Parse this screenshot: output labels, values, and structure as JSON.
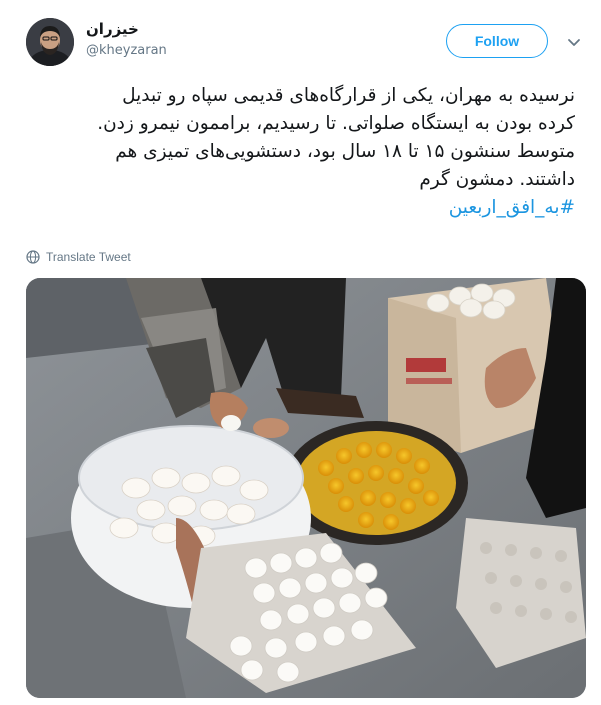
{
  "author": {
    "display_name": "خیزران",
    "handle": "@kheyzaran"
  },
  "follow_button": {
    "label": "Follow"
  },
  "tweet": {
    "lines": [
      "نرسیده به مهران، یکی از قرارگاه‌های قدیمی سپاه رو تبدیل",
      "کرده بودن به ایستگاه صلواتی. تا رسیدیم، براممون نیمرو زدن.",
      "متوسط سنشون ۱۵ تا ۱۸ سال بود، دستشویی‌های تمیزی هم",
      "داشتند. دمشون گرم"
    ],
    "hashtag": "#به_افق_اربعین"
  },
  "translate": {
    "label": "Translate Tweet"
  },
  "icons": {
    "caret": "chevron-down-icon",
    "globe": "globe-icon"
  },
  "colors": {
    "accent": "#1da1f2",
    "hashtag": "#1b95e0",
    "muted": "#657786"
  }
}
